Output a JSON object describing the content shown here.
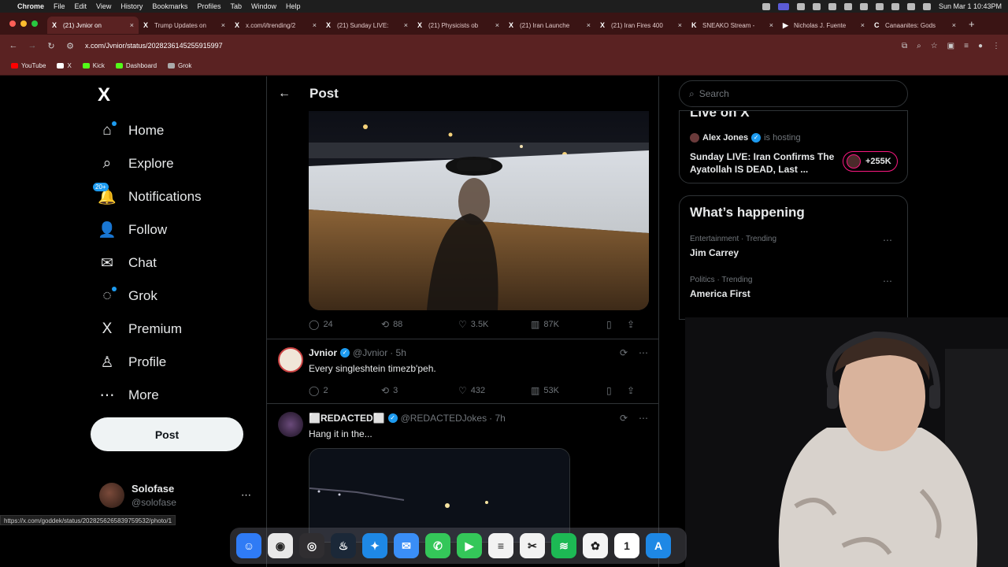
{
  "menubar": {
    "app": "Chrome",
    "items": [
      "File",
      "Edit",
      "View",
      "History",
      "Bookmarks",
      "Profiles",
      "Tab",
      "Window",
      "Help"
    ],
    "clock": "Sun Mar 1  10:43PM"
  },
  "tabs": [
    {
      "icon": "X",
      "label": "(21) Jvnior on"
    },
    {
      "icon": "X",
      "label": "Trump Updates on"
    },
    {
      "icon": "X",
      "label": "x.com/i/trending/2"
    },
    {
      "icon": "X",
      "label": "(21) Sunday LIVE:"
    },
    {
      "icon": "X",
      "label": "(21) Physicists ob"
    },
    {
      "icon": "X",
      "label": "(21) Iran Launche"
    },
    {
      "icon": "X",
      "label": "(21) Iran Fires 400"
    },
    {
      "icon": "K",
      "label": "SNEAKO Stream -"
    },
    {
      "icon": "▶",
      "label": "Nicholas J. Fuente"
    },
    {
      "icon": "C",
      "label": "Canaanites: Gods"
    }
  ],
  "address": {
    "url": "x.com/Jvnior/status/2028236145255915997"
  },
  "bookmarks": [
    {
      "label": "YouTube",
      "color": "#ff0000"
    },
    {
      "label": "X",
      "color": "#ffffff"
    },
    {
      "label": "Kick",
      "color": "#53fc18"
    },
    {
      "label": "Dashboard",
      "color": "#53fc18"
    },
    {
      "label": "Grok",
      "color": "#aaaaaa"
    }
  ],
  "nav": {
    "logo": "X",
    "items": [
      {
        "label": "Home",
        "icon": "⌂"
      },
      {
        "label": "Explore",
        "icon": "⌕"
      },
      {
        "label": "Notifications",
        "icon": "🔔",
        "badge": "20+"
      },
      {
        "label": "Follow",
        "icon": "👤"
      },
      {
        "label": "Chat",
        "icon": "✉"
      },
      {
        "label": "Grok",
        "icon": "◌"
      },
      {
        "label": "Premium",
        "icon": "X"
      },
      {
        "label": "Profile",
        "icon": "♙"
      },
      {
        "label": "More",
        "icon": "⋯"
      }
    ],
    "post_button": "Post",
    "user": {
      "name": "Solofase",
      "handle": "@solofase"
    }
  },
  "status_url": "https://x.com/goddek/status/2028256265839759532/photo/1",
  "post": {
    "header": "Post",
    "stats": {
      "replies": "24",
      "reposts": "88",
      "likes": "3.5K",
      "views": "87K"
    }
  },
  "replies": [
    {
      "name": "Jvnior",
      "handle": "@Jvnior",
      "time": "· 5h",
      "text": "Every singleshtein timezb'peh.",
      "stats": {
        "replies": "2",
        "reposts": "3",
        "likes": "432",
        "views": "53K"
      }
    },
    {
      "name": "⬜REDACTED⬜",
      "handle": "@REDACTEDJokes",
      "time": "· 7h",
      "text": "Hang it in the..."
    }
  ],
  "right": {
    "search_placeholder": "Search",
    "live": {
      "title": "Live on X",
      "host": "Alex Jones",
      "hosting": "is hosting",
      "text": "Sunday LIVE: Iran Confirms The Ayatollah IS DEAD, Last ...",
      "count": "+255K"
    },
    "happening": {
      "title": "What’s happening",
      "trends": [
        {
          "meta": "Entertainment · Trending",
          "name": "Jim Carrey"
        },
        {
          "meta": "Politics · Trending",
          "name": "America First"
        }
      ]
    }
  },
  "dock": [
    {
      "name": "finder",
      "color": "#2f7bf5",
      "glyph": "☺"
    },
    {
      "name": "chrome",
      "color": "#e8e8e8",
      "glyph": "◉"
    },
    {
      "name": "obs",
      "color": "#302e31",
      "glyph": "◎"
    },
    {
      "name": "steam",
      "color": "#1b2838",
      "glyph": "♨"
    },
    {
      "name": "safari",
      "color": "#1e88e5",
      "glyph": "✦"
    },
    {
      "name": "mail",
      "color": "#3a8ef6",
      "glyph": "✉"
    },
    {
      "name": "messages",
      "color": "#34c759",
      "glyph": "✆"
    },
    {
      "name": "facetime",
      "color": "#34c759",
      "glyph": "▶"
    },
    {
      "name": "notes",
      "color": "#f2f2f2",
      "glyph": "≡"
    },
    {
      "name": "capcut",
      "color": "#f2f2f2",
      "glyph": "✂"
    },
    {
      "name": "spotify",
      "color": "#1db954",
      "glyph": "≋"
    },
    {
      "name": "photos",
      "color": "#f4f4f4",
      "glyph": "✿"
    },
    {
      "name": "calendar",
      "color": "#ffffff",
      "glyph": "1"
    },
    {
      "name": "appstore",
      "color": "#1e88e5",
      "glyph": "A"
    }
  ]
}
